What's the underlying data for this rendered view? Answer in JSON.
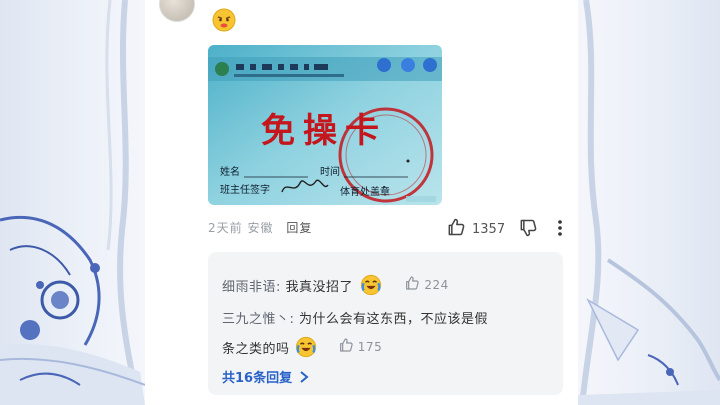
{
  "comment": {
    "image_text": {
      "title": "免操卡",
      "name_label": "姓名",
      "time_label": "时间",
      "teacher_label": "班主任签字",
      "office_label": "体育处盖章"
    },
    "meta": {
      "time": "2天前",
      "location": "安徽",
      "reply": "回复"
    },
    "likes": "1357"
  },
  "replies": [
    {
      "author": "细雨非语",
      "text": "我真没招了",
      "likes": "224"
    },
    {
      "author": "三九之惟丶",
      "text_line1": "为什么会有这东西，不应该是假",
      "text_line2": "条之类的吗",
      "likes": "175"
    }
  ],
  "more_replies": "共16条回复",
  "colors": {
    "link": "#2a62c9",
    "stamp_red": "#c4161c"
  },
  "icons": [
    "thumbs-up-icon",
    "thumbs-down-icon",
    "more-vertical-icon",
    "chevron-right-icon",
    "laughing-crying-emoji-icon",
    "pouting-emoji-icon"
  ]
}
